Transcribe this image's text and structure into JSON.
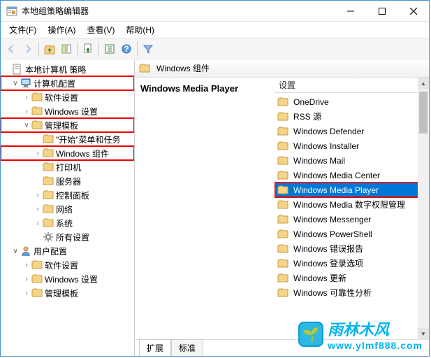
{
  "window": {
    "title": "本地组策略编辑器"
  },
  "menu": {
    "file": "文件(F)",
    "action": "操作(A)",
    "view": "查看(V)",
    "help": "帮助(H)"
  },
  "tree": {
    "root": "本地计算机 策略",
    "computer_config": "计算机配置",
    "software_settings": "软件设置",
    "windows_settings": "Windows 设置",
    "admin_templates": "管理模板",
    "start_menu": "\"开始\"菜单和任务",
    "windows_components": "Windows 组件",
    "printers": "打印机",
    "servers": "服务器",
    "control_panel": "控制面板",
    "network": "网络",
    "system": "系统",
    "all_settings": "所有设置",
    "user_config": "用户配置",
    "u_software_settings": "软件设置",
    "u_windows_settings": "Windows 设置",
    "u_admin_templates": "管理模板"
  },
  "list": {
    "header": "Windows 组件",
    "detail_title": "Windows Media Player",
    "col_settings": "设置",
    "items": [
      "OneDrive",
      "RSS 源",
      "Windows Defender",
      "Windows Installer",
      "Windows Mail",
      "Windows Media Center",
      "Windows Media Player",
      "Windows Media 数字权限管理",
      "Windows Messenger",
      "Windows PowerShell",
      "Windows 错误报告",
      "Windows 登录选项",
      "Windows 更新",
      "Windows 可靠性分析"
    ],
    "selected_index": 6
  },
  "tabs": {
    "extended": "扩展",
    "standard": "标准"
  },
  "watermark": {
    "brand": "雨林木风",
    "url": "www.ylmf888.com"
  }
}
